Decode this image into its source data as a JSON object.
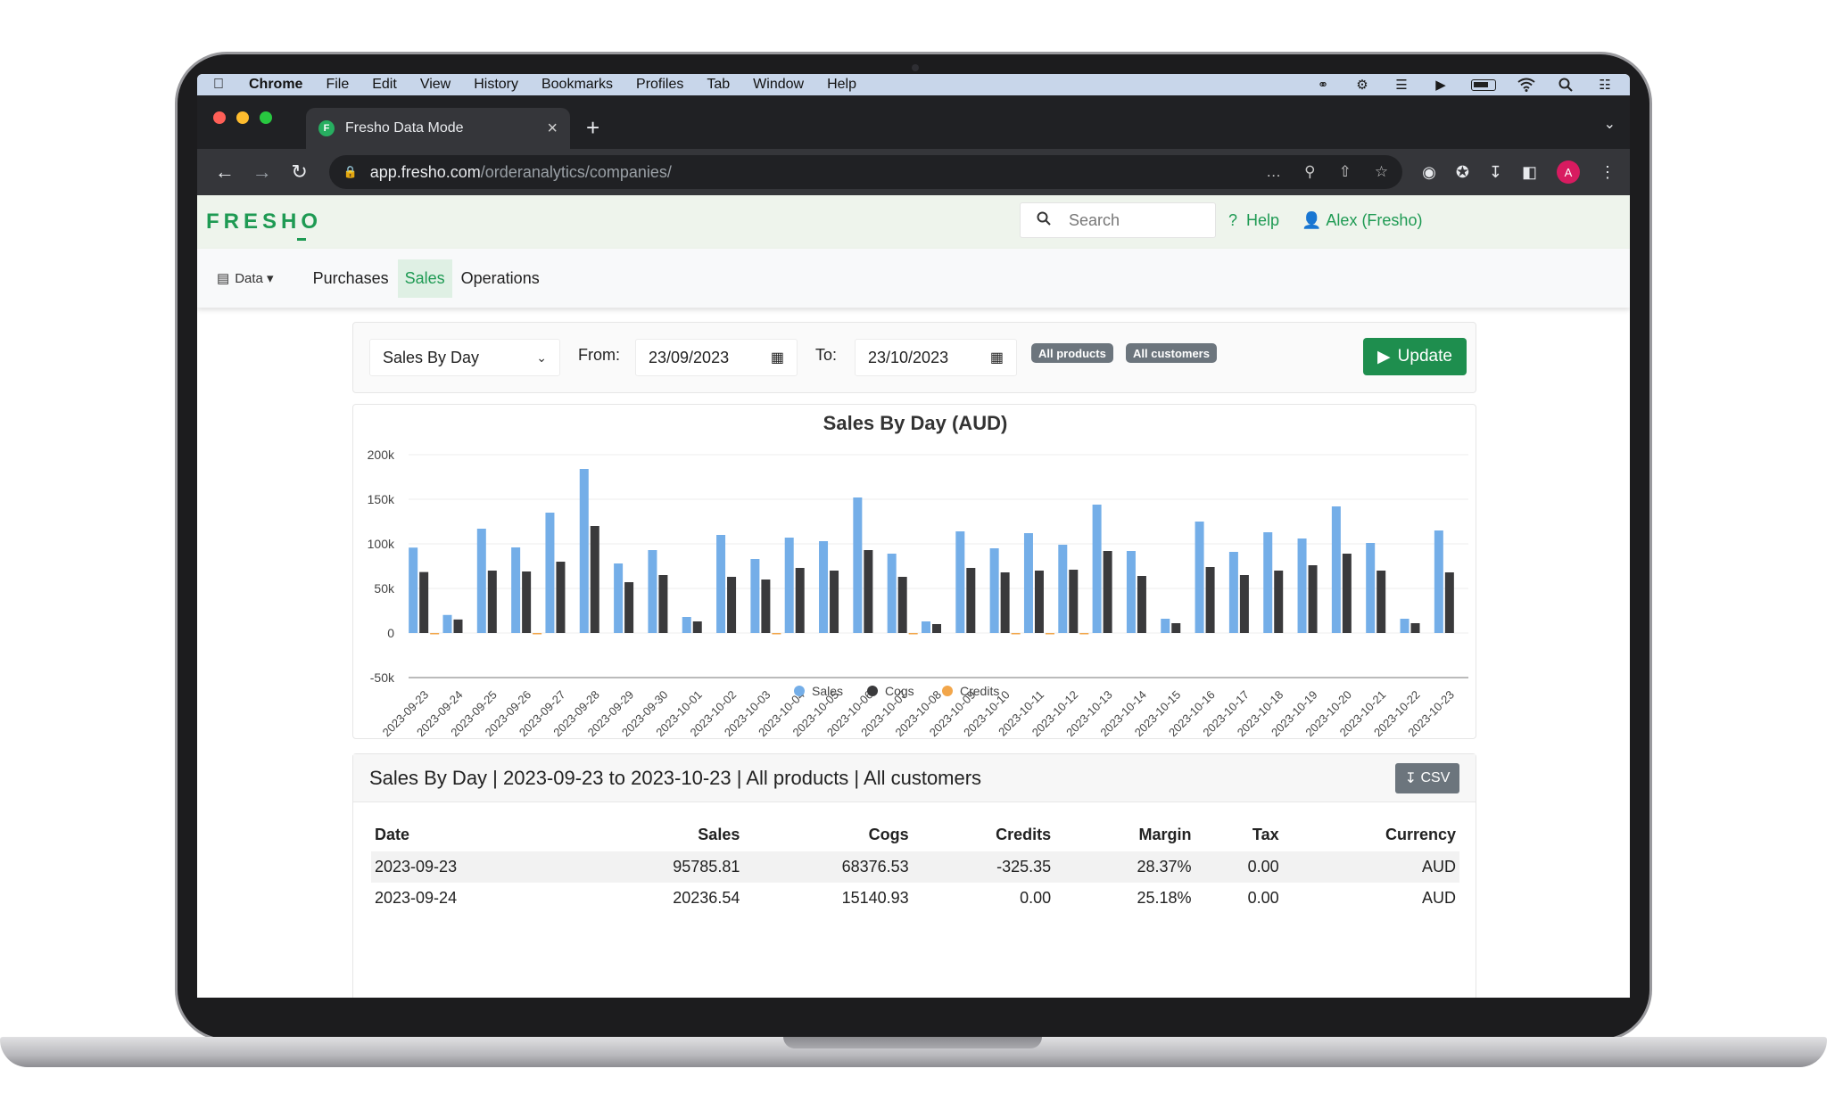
{
  "menubar": {
    "items": [
      "Chrome",
      "File",
      "Edit",
      "View",
      "History",
      "Bookmarks",
      "Profiles",
      "Tab",
      "Window",
      "Help"
    ]
  },
  "browser": {
    "tab_title": "Fresho Data Mode",
    "favicon_letter": "F",
    "url_host": "app.fresho.com",
    "url_path": "/orderanalytics/companies/",
    "profile_initial": "A"
  },
  "header": {
    "logo": "FRESHO",
    "search_placeholder": "Search",
    "help_label": "Help",
    "user_label": "Alex (Fresho)"
  },
  "nav": {
    "data_menu": "Data",
    "links": [
      "Purchases",
      "Sales",
      "Operations"
    ],
    "active": "Sales"
  },
  "filters": {
    "report": "Sales By Day",
    "from_label": "From:",
    "from_value": "23/09/2023",
    "to_label": "To:",
    "to_value": "23/10/2023",
    "chip_products": "All products",
    "chip_customers": "All customers",
    "update_label": "Update"
  },
  "colors": {
    "sales": "#74aee8",
    "cogs": "#3a3a3c",
    "credits": "#f2a64a",
    "brand": "#1e9a53"
  },
  "chart_data": {
    "type": "bar",
    "title": "Sales By Day (AUD)",
    "ylim": [
      -50000,
      200000
    ],
    "yticks": [
      "200k",
      "150k",
      "100k",
      "50k",
      "0",
      "-50k"
    ],
    "categories": [
      "2023-09-23",
      "2023-09-24",
      "2023-09-25",
      "2023-09-26",
      "2023-09-27",
      "2023-09-28",
      "2023-09-29",
      "2023-09-30",
      "2023-10-01",
      "2023-10-02",
      "2023-10-03",
      "2023-10-04",
      "2023-10-05",
      "2023-10-06",
      "2023-10-07",
      "2023-10-08",
      "2023-10-09",
      "2023-10-10",
      "2023-10-11",
      "2023-10-12",
      "2023-10-13",
      "2023-10-14",
      "2023-10-15",
      "2023-10-16",
      "2023-10-17",
      "2023-10-18",
      "2023-10-19",
      "2023-10-20",
      "2023-10-21",
      "2023-10-22",
      "2023-10-23"
    ],
    "series": [
      {
        "name": "Sales",
        "values": [
          95786,
          20236,
          117000,
          96000,
          135000,
          184000,
          78000,
          93000,
          18000,
          110000,
          83000,
          107000,
          103000,
          152000,
          89000,
          13000,
          114000,
          95000,
          112000,
          99000,
          144000,
          92000,
          16000,
          125000,
          91000,
          113000,
          106000,
          142000,
          101000,
          16000,
          115000
        ]
      },
      {
        "name": "Cogs",
        "values": [
          68377,
          15141,
          70000,
          69000,
          80000,
          120000,
          57000,
          65000,
          13000,
          63000,
          60000,
          73000,
          70000,
          93000,
          63000,
          10000,
          73000,
          68000,
          70000,
          71000,
          92000,
          64000,
          11000,
          74000,
          65000,
          70000,
          76000,
          89000,
          70000,
          11000,
          68000
        ]
      },
      {
        "name": "Credits",
        "values": [
          -325,
          0,
          0,
          -800,
          0,
          0,
          0,
          0,
          0,
          0,
          -700,
          0,
          0,
          0,
          -900,
          0,
          0,
          -700,
          -600,
          -700,
          0,
          0,
          0,
          0,
          0,
          0,
          0,
          0,
          0,
          0,
          0
        ]
      }
    ]
  },
  "table": {
    "title": "Sales By Day | 2023-09-23 to 2023-10-23 | All products | All customers",
    "csv_label": "CSV",
    "columns": [
      "Date",
      "Sales",
      "Cogs",
      "Credits",
      "Margin",
      "Tax",
      "Currency"
    ],
    "rows": [
      [
        "2023-09-23",
        "95785.81",
        "68376.53",
        "-325.35",
        "28.37%",
        "0.00",
        "AUD"
      ],
      [
        "2023-09-24",
        "20236.54",
        "15140.93",
        "0.00",
        "25.18%",
        "0.00",
        "AUD"
      ]
    ]
  }
}
